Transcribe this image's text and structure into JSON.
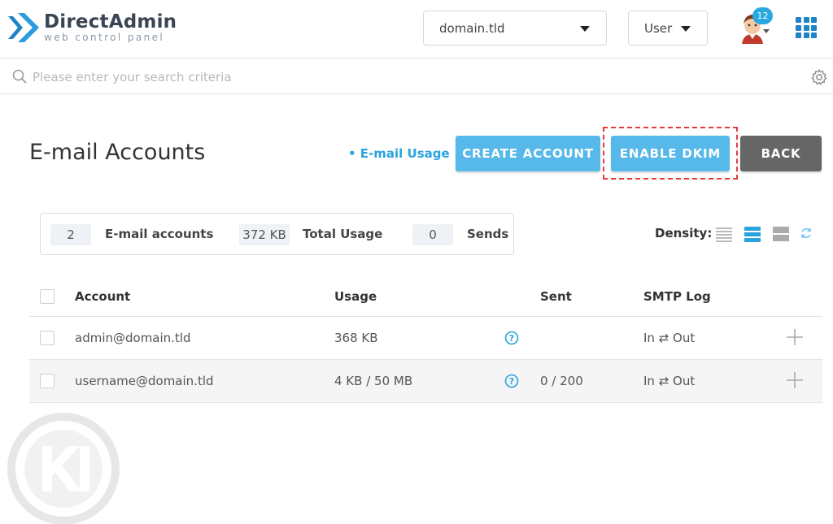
{
  "brand": {
    "title": "DirectAdmin",
    "subtitle": "web control panel"
  },
  "header": {
    "domain_select": "domain.tld",
    "user_select": "User",
    "notification_count": "12"
  },
  "search": {
    "placeholder": "Please enter your search criteria"
  },
  "page": {
    "title": "E-mail Accounts",
    "usage_link": "• E-mail Usage",
    "create_button": "CREATE ACCOUNT",
    "dkim_button": "ENABLE DKIM",
    "back_button": "BACK"
  },
  "stats": {
    "accounts_count": "2",
    "accounts_label": "E-mail accounts",
    "usage_value": "372 KB",
    "usage_label": "Total Usage",
    "sends_value": "0",
    "sends_label": "Sends"
  },
  "density": {
    "label": "Density:",
    "selected": "medium"
  },
  "table": {
    "columns": [
      "Account",
      "Usage",
      "Sent",
      "SMTP Log"
    ],
    "rows": [
      {
        "account": "admin@domain.tld",
        "usage": "368 KB",
        "sent": "",
        "smtp_log": "In ⇄ Out"
      },
      {
        "account": "username@domain.tld",
        "usage": "4 KB / 50 MB",
        "sent": "0 / 200",
        "smtp_log": "In ⇄ Out"
      }
    ]
  },
  "colors": {
    "accent": "#57b9ea",
    "link": "#29a3dd",
    "back": "#666666",
    "highlight": "#e53935"
  }
}
